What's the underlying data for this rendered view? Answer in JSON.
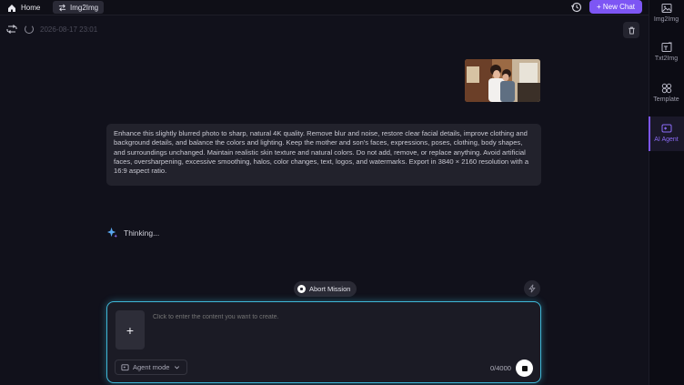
{
  "topbar": {
    "home_label": "Home",
    "home_icon": "home-icon",
    "tab_label": "Img2Img",
    "tab_icon": "swap-icon",
    "history_icon": "history-icon",
    "new_chat_label": "+ New Chat",
    "accent_color": "#7d56f4"
  },
  "sidebar": {
    "items": [
      {
        "label": "Img2Img",
        "icon": "image-icon"
      },
      {
        "label": "Txt2Img",
        "icon": "text-image-icon"
      },
      {
        "label": "Template",
        "icon": "grid-icon"
      },
      {
        "label": "AI Agent",
        "icon": "agent-icon",
        "active": true
      }
    ]
  },
  "session": {
    "timestamp": "2026-08-17  23:01",
    "refresh_icon": "refresh-icon",
    "loading_icon": "spinner-icon",
    "delete_icon": "trash-icon"
  },
  "chat": {
    "prompt_text": "Enhance this slightly blurred photo to sharp, natural 4K quality. Remove blur and noise, restore clear facial details, improve clothing and background details, and balance the colors and lighting. Keep the mother and son's faces, expressions, poses, clothing, body shapes, and surroundings unchanged. Maintain realistic skin texture and natural colors. Do not add, remove, or replace anything. Avoid artificial faces, oversharpening, excessive smoothing, halos, color changes, text, logos, and watermarks. Export in 3840 × 2160 resolution with a 16:9 aspect ratio.",
    "status_text": "Thinking...",
    "status_icon": "sparkle-icon"
  },
  "actions": {
    "abort_label": "Abort Mission",
    "bolt_icon": "bolt-icon"
  },
  "composer": {
    "placeholder": "Click to enter the content you want to create.",
    "add_label": "+",
    "mode_label": "Agent mode",
    "mode_icon": "agent-mode-icon",
    "counter": "0/4000",
    "border_color": "#3fb8d8"
  }
}
